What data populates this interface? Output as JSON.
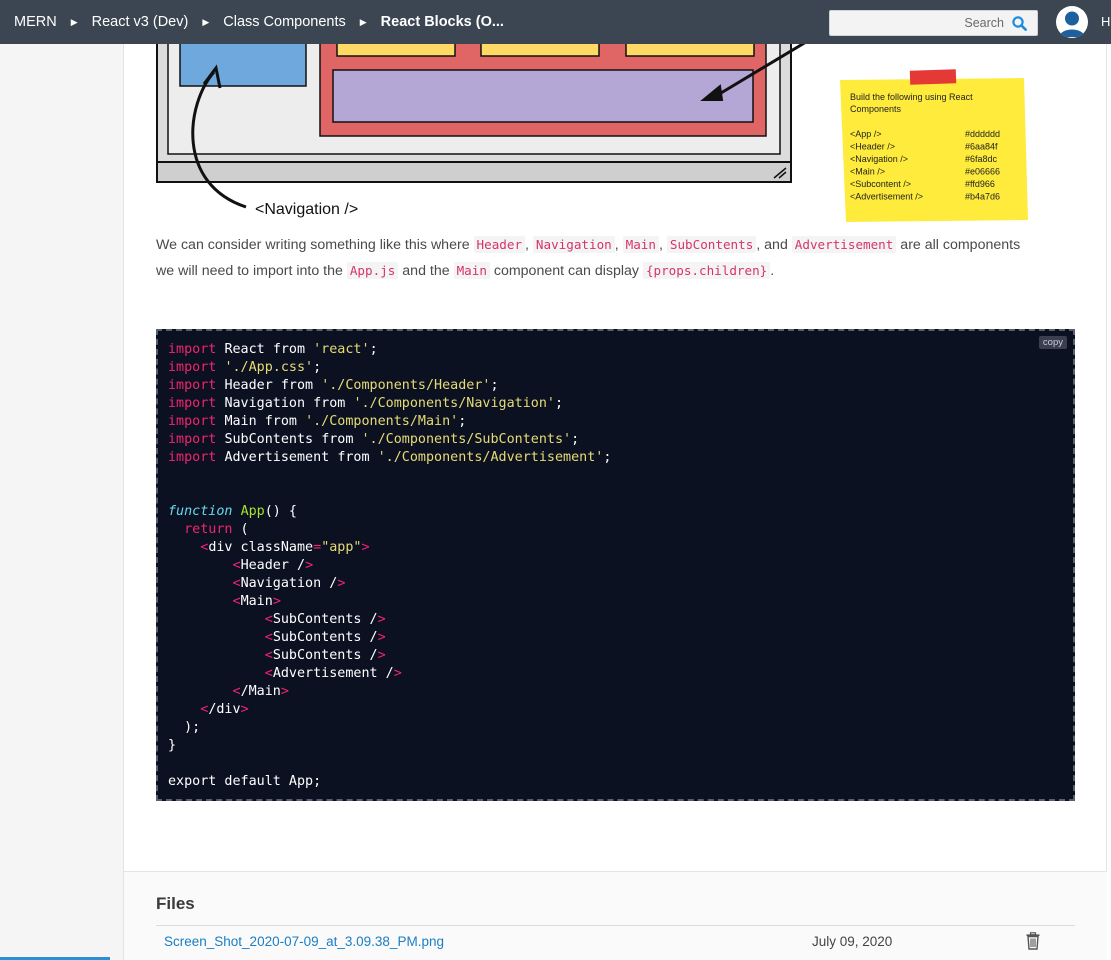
{
  "breadcrumb": {
    "items": [
      "MERN",
      "React v3 (Dev)",
      "Class Components",
      "React Blocks (O..."
    ]
  },
  "search": {
    "placeholder": "Search"
  },
  "user": {
    "initial": "H"
  },
  "illustration": {
    "navigation_label": "<Navigation />",
    "note": {
      "line1": "Build the following using React",
      "line2": "Components",
      "rows": [
        {
          "name": "<App />",
          "color": "#dddddd"
        },
        {
          "name": "<Header />",
          "color": "#6aa84f"
        },
        {
          "name": "<Navigation />",
          "color": "#6fa8dc"
        },
        {
          "name": "<Main />",
          "color": "#e06666"
        },
        {
          "name": "<Subcontent />",
          "color": "#ffd966"
        },
        {
          "name": "<Advertisement />",
          "color": "#b4a7d6"
        }
      ]
    }
  },
  "paragraph": {
    "t1": "We can consider writing something like this where ",
    "c1": "Header",
    "t2": ", ",
    "c2": "Navigation",
    "t3": ", ",
    "c3": "Main",
    "t4": ", ",
    "c4": "SubContents",
    "t5": ", and ",
    "c5": "Advertisement",
    "t6": " are all components we will need to import into the ",
    "c6": "App.js",
    "t7": " and the ",
    "c7": "Main",
    "t8": " component can display ",
    "c8": "{props.children}",
    "t9": "."
  },
  "code": {
    "copy_label": "copy",
    "kw_import": "import",
    "kw_from": "from",
    "l1_name": "React",
    "l1_src": "'react'",
    "l2_src": "'./App.css'",
    "l3_name": "Header",
    "l3_src": "'./Components/Header'",
    "l4_name": "Navigation",
    "l4_src": "'./Components/Navigation'",
    "l5_name": "Main",
    "l5_src": "'./Components/Main'",
    "l6_name": "SubContents",
    "l6_src": "'./Components/SubContents'",
    "l7_name": "Advertisement",
    "l7_src": "'./Components/Advertisement'",
    "kw_function": "function",
    "fn_name": "App",
    "kw_return": "return",
    "class_value": "\"app\"",
    "export_line": "export default App;"
  },
  "files": {
    "title": "Files",
    "items": [
      {
        "name": "Screen_Shot_2020-07-09_at_3.09.38_PM.png",
        "date": "July 09, 2020"
      }
    ]
  }
}
